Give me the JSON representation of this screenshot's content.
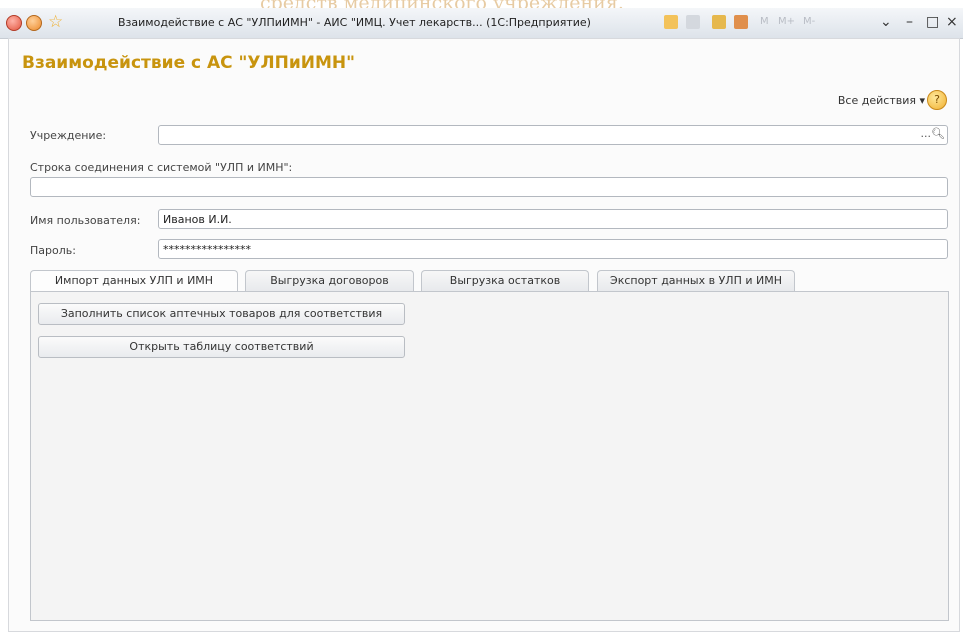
{
  "overlay_text": "средств медицинского учреждения.",
  "window": {
    "title": "Взаимодействие с АС \"УЛПиИМН\" - АИС \"ИМЦ. Учет лекарств... (1С:Предприятие)",
    "m_buttons": [
      "M",
      "M+",
      "M-"
    ],
    "controls": {
      "down": "⌄",
      "minimize": "–",
      "maximize": "□",
      "close": "×"
    }
  },
  "form": {
    "title": "Взаимодействие с АС \"УЛПиИМН\"",
    "all_actions": "Все действия ▾",
    "help": "?",
    "institution_label": "Учреждение:",
    "institution_value": "",
    "institution_select": "...",
    "connection_label": "Строка соединения с системой \"УЛП и ИМН\":",
    "connection_value": "",
    "user_label": "Имя пользователя:",
    "user_value": "Иванов И.И.",
    "password_label": "Пароль:",
    "password_value": "****************"
  },
  "tabs": [
    {
      "label": "Импорт данных УЛП и ИМН",
      "active": true
    },
    {
      "label": "Выгрузка договоров",
      "active": false
    },
    {
      "label": "Выгрузка остатков",
      "active": false
    },
    {
      "label": "Экспорт данных в УЛП и ИМН",
      "active": false
    }
  ],
  "actions": {
    "fill_list": "Заполнить список аптечных товаров для соответствия",
    "open_table": "Открыть таблицу соответствий"
  },
  "colors": {
    "title": "#c8940e",
    "overlay": "#d4a259"
  }
}
